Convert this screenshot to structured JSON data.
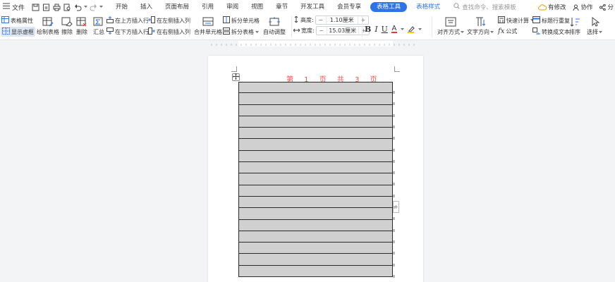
{
  "menubar": {
    "file_label": "文件",
    "tabs": [
      {
        "label": "开始"
      },
      {
        "label": "插入"
      },
      {
        "label": "页面布局"
      },
      {
        "label": "引用"
      },
      {
        "label": "审阅"
      },
      {
        "label": "视图"
      },
      {
        "label": "章节"
      },
      {
        "label": "开发工具"
      },
      {
        "label": "会员专享"
      },
      {
        "label": "表格工具"
      },
      {
        "label": "表格样式"
      }
    ],
    "search_placeholder": "查找命令、搜索模板",
    "right": {
      "modified_label": "有修改",
      "collab_label": "协作",
      "share_label": "分"
    }
  },
  "ribbon": {
    "table_props": "表格属性",
    "show_gridlines": "显示虚框",
    "draw_table": "绘制表格",
    "erase": "擦除",
    "delete": "删除",
    "summary": "汇总",
    "insert_above": "在上方插入行",
    "insert_below": "在下方插入行",
    "insert_left": "在左侧插入列",
    "insert_right": "在右侧插入列",
    "merge_cells": "合并单元格",
    "split_cells": "拆分单元格",
    "split_table": "拆分表格",
    "autofit": "自动调整",
    "height_label": "高度:",
    "height_value": "1.10厘米",
    "width_label": "宽度:",
    "width_value": "15.03厘米",
    "align": "对齐方式",
    "text_direction": "文字方向",
    "quick_calc": "快速计算",
    "formula": "公式",
    "repeat_header": "标题行重复",
    "convert_text": "转换成文本",
    "sort": "排序",
    "select": "选择"
  },
  "document": {
    "page_header": "第 1 页 共 3 页",
    "table_rows": 17
  },
  "colors": {
    "accent": "#2f73e8",
    "header_text": "#e8564f",
    "cell_fill": "#d0d0d0",
    "font_color_underline": "#e53935",
    "highlight_underline": "#f5d000"
  }
}
